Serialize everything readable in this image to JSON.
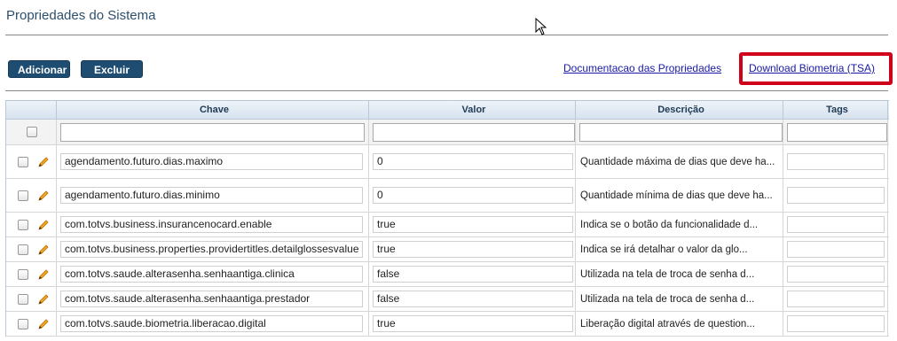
{
  "page": {
    "title": "Propriedades do Sistema"
  },
  "toolbar": {
    "add_label": "Adicionar",
    "delete_label": "Excluir",
    "doc_link": "Documentacao das Propriedades",
    "bio_link": "Download Biometria (TSA)"
  },
  "table": {
    "headers": {
      "key": "Chave",
      "value": "Valor",
      "description": "Descrição",
      "tags": "Tags"
    },
    "rows": [
      {
        "key": "agendamento.futuro.dias.maximo",
        "value": "0",
        "description": "Quantidade máxima de dias que deve ha..."
      },
      {
        "key": "agendamento.futuro.dias.minimo",
        "value": "0",
        "description": "Quantidade mínima de dias que deve ha..."
      },
      {
        "key": "com.totvs.business.insurancenocard.enable",
        "value": "true",
        "description": "Indica se o botão da funcionalidade d..."
      },
      {
        "key": "com.totvs.business.properties.providertitles.detailglossesvalue",
        "value": "true",
        "description": "Indica se irá detalhar o valor da glo..."
      },
      {
        "key": "com.totvs.saude.alterasenha.senhaantiga.clinica",
        "value": "false",
        "description": "Utilizada na tela de troca de senha d..."
      },
      {
        "key": "com.totvs.saude.alterasenha.senhaantiga.prestador",
        "value": "false",
        "description": "Utilizada na tela de troca de senha d..."
      },
      {
        "key": "com.totvs.saude.biometria.liberacao.digital",
        "value": "true",
        "description": "Liberação digital através de question..."
      }
    ]
  },
  "colors": {
    "button": "#1f4d72",
    "highlight": "#d0021b",
    "link": "#1a1aa6"
  }
}
